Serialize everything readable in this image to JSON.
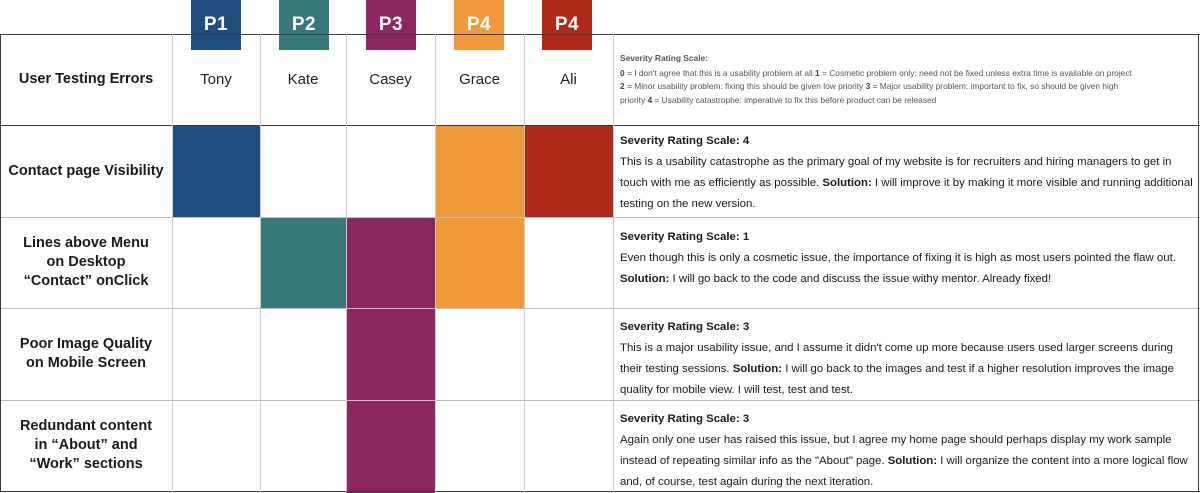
{
  "participants": [
    {
      "tab": "P1",
      "name": "Tony",
      "color": "#1f4e7e"
    },
    {
      "tab": "P2",
      "name": "Kate",
      "color": "#37787a"
    },
    {
      "tab": "P3",
      "name": "Casey",
      "color": "#8b2660"
    },
    {
      "tab": "P4",
      "name": "Grace",
      "color": "#f0993a"
    },
    {
      "tab": "P4",
      "name": "Ali",
      "color": "#ad2a1a"
    }
  ],
  "header": {
    "label": "User Testing Errors",
    "scale_title": "Severity Rating Scale:",
    "scale_lines": [
      {
        "n0": "0",
        "t0": " = I don't agree that this is a usability problem at all  ",
        "n1": "1",
        "t1": " = Cosmetic problem only: need not be fixed unless extra time is available on project"
      },
      {
        "n0": "2",
        "t0": " = Minor usability problem: fixing this should be given low priority  ",
        "n1": "3",
        "t1": " = Major usability problem: important to fix, so should be given high"
      },
      {
        "n0": "",
        "t0": "priority  ",
        "n1": "4",
        "t1": " = Usability catastrophe: imperative to fix this before product can be released"
      }
    ]
  },
  "rows": [
    {
      "label": "Contact page Visibility",
      "title": "Severity Rating Scale: 4",
      "text": "This is a usability catastrophe as the primary goal of my website is for recruiters and hiring managers to get in touch with me as efficiently as possible. ",
      "solution_label": "Solution:",
      "solution": " I will improve it by making it more visible and running additional testing on the new version."
    },
    {
      "label": "Lines above Menu on Desktop “Contact” onClick",
      "title": "Severity Rating Scale: 1",
      "text": "Even though this is only a cosmetic issue, the importance of fixing it is high as most users pointed the flaw out. ",
      "solution_label": "Solution:",
      "solution": " I will go back to the code and discuss the issue withy mentor. Already fixed!"
    },
    {
      "label": "Poor Image Quality on Mobile Screen",
      "title": "Severity Rating Scale: 3",
      "text": "This is a major usability issue, and I assume it didn't come up more because users used larger screens during their testing sessions. ",
      "solution_label": "Solution:",
      "solution": " I will go back to the images and test if a higher resolution improves the image quality for mobile view. I will test, test and test."
    },
    {
      "label": "Redundant content in “About” and “Work” sections",
      "title": "Severity Rating Scale: 3",
      "text": "Again only one user has raised this issue, but I agree my home page should perhaps display my work sample instead of repeating similar info as the \"About\" page. ",
      "solution_label": "Solution:",
      "solution": " I will organize the content into a more logical flow and, of course, test again during the next iteration."
    }
  ]
}
